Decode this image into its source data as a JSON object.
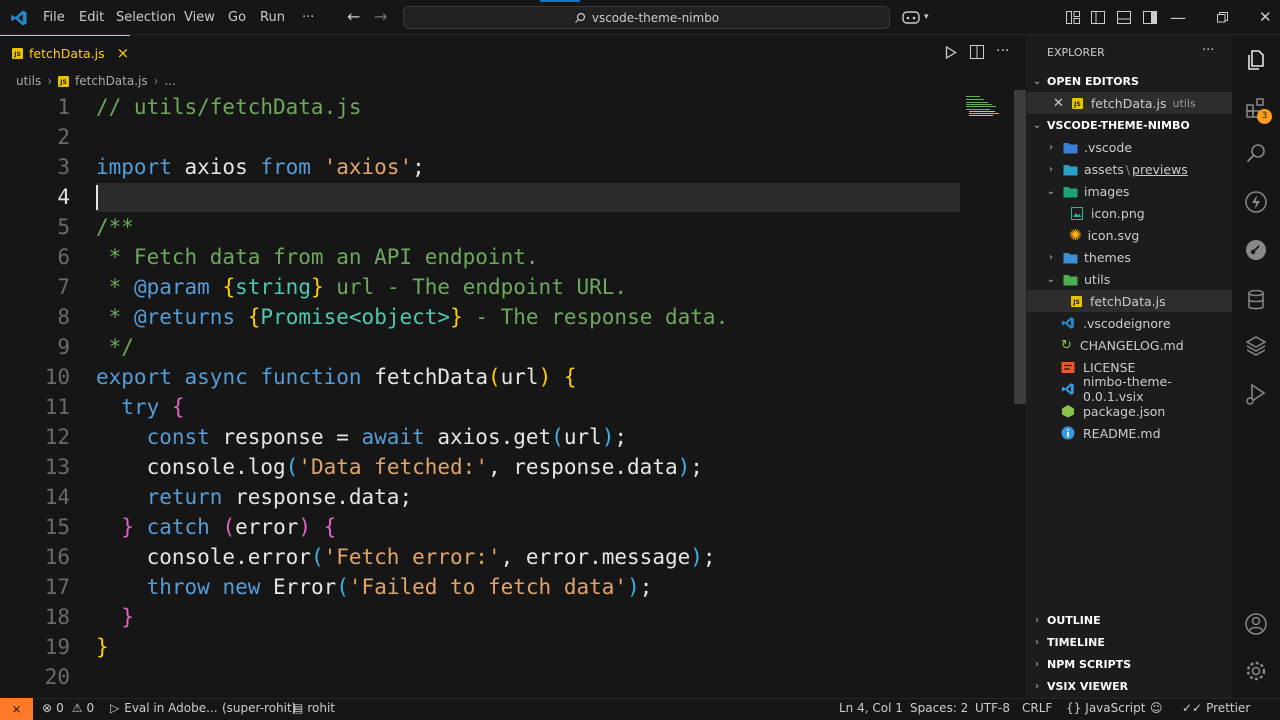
{
  "titlebar": {
    "menu": [
      "File",
      "Edit",
      "Selection",
      "View",
      "Go",
      "Run",
      "···"
    ],
    "search_text": "vscode-theme-nimbo"
  },
  "tab": {
    "label": "fetchData.js",
    "close": "×",
    "badge": "JS"
  },
  "breadcrumb": {
    "folder": "utils",
    "file": "fetchData.js",
    "more": "..."
  },
  "editor": {
    "line_numbers": [
      "1",
      "2",
      "3",
      "4",
      "5",
      "6",
      "7",
      "8",
      "9",
      "10",
      "11",
      "12",
      "13",
      "14",
      "15",
      "16",
      "17",
      "18",
      "19",
      "20"
    ],
    "current_line": "4"
  },
  "explorer": {
    "title": "EXPLORER",
    "more": "···",
    "open_editors": "OPEN EDITORS",
    "open_file": "fetchData.js",
    "open_file_dir": "utils",
    "project": "VSCODE-THEME-NIMBO",
    "items": [
      {
        "label": ".vscode"
      },
      {
        "label": "assets",
        "extra": "previews"
      },
      {
        "label": "images"
      },
      {
        "label": "icon.png"
      },
      {
        "label": "icon.svg"
      },
      {
        "label": "themes"
      },
      {
        "label": "utils"
      },
      {
        "label": "fetchData.js"
      },
      {
        "label": ".vscodeignore"
      },
      {
        "label": "CHANGELOG.md"
      },
      {
        "label": "LICENSE"
      },
      {
        "label": "nimbo-theme-0.0.1.vsix"
      },
      {
        "label": "package.json"
      },
      {
        "label": "README.md"
      }
    ],
    "sections": [
      "OUTLINE",
      "TIMELINE",
      "NPM SCRIPTS",
      "VSIX VIEWER"
    ]
  },
  "activity": {
    "extensions_badge": "3"
  },
  "status": {
    "errors": "0",
    "warnings": "0",
    "eval": "Eval in Adobe...",
    "user": "(super-rohit)",
    "account": "rohit",
    "position": "Ln 4, Col 1",
    "spaces": "Spaces: 2",
    "encoding": "UTF-8",
    "eol": "CRLF",
    "language": "JavaScript",
    "prettier": "Prettier"
  },
  "colors": {
    "accent": "#ffd000",
    "remote": "#ff7b2b",
    "keyword": "#569cd6",
    "string": "#e0a56a",
    "comment": "#6ea85d"
  }
}
